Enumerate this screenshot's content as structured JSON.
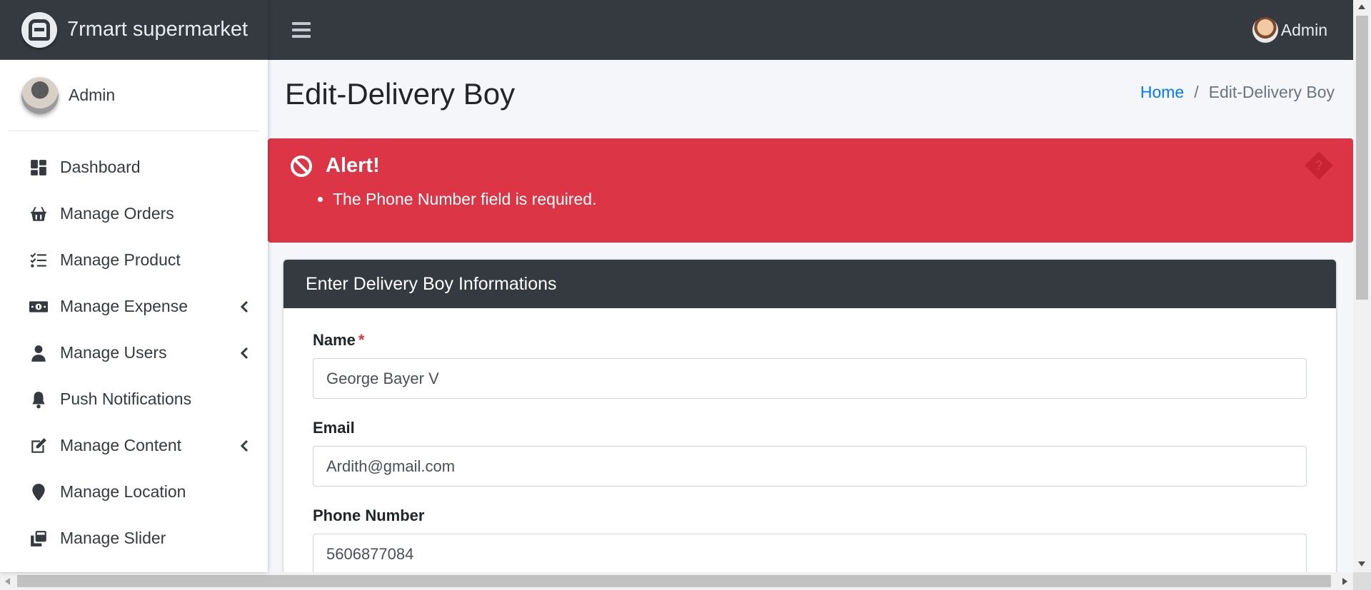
{
  "brand": {
    "name": "7rmart supermarket",
    "icon": "brand-logo-icon"
  },
  "sidebar": {
    "user": {
      "name": "Admin"
    },
    "items": [
      {
        "label": "Dashboard",
        "icon": "dashboard-icon",
        "has_submenu": false
      },
      {
        "label": "Manage Orders",
        "icon": "basket-icon",
        "has_submenu": false
      },
      {
        "label": "Manage Product",
        "icon": "tasks-icon",
        "has_submenu": false
      },
      {
        "label": "Manage Expense",
        "icon": "money-icon",
        "has_submenu": true
      },
      {
        "label": "Manage Users",
        "icon": "user-icon",
        "has_submenu": true
      },
      {
        "label": "Push Notifications",
        "icon": "bell-icon",
        "has_submenu": false
      },
      {
        "label": "Manage Content",
        "icon": "edit-icon",
        "has_submenu": true
      },
      {
        "label": "Manage Location",
        "icon": "map-marker-icon",
        "has_submenu": false
      },
      {
        "label": "Manage Slider",
        "icon": "clone-icon",
        "has_submenu": false
      }
    ]
  },
  "topbar": {
    "user_name": "Admin"
  },
  "page": {
    "title": "Edit-Delivery Boy",
    "breadcrumb": {
      "home": "Home",
      "separator": "/",
      "current": "Edit-Delivery Boy"
    }
  },
  "alert": {
    "title": "Alert!",
    "messages": [
      "The Phone Number field is required."
    ],
    "color": "#dc3545"
  },
  "form": {
    "header": "Enter Delivery Boy Informations",
    "name": {
      "label": "Name",
      "required_mark": "*",
      "value": "George Bayer V"
    },
    "email": {
      "label": "Email",
      "value": "Ardith@gmail.com"
    },
    "phone": {
      "label": "Phone Number",
      "value": "5606877084"
    }
  },
  "colors": {
    "dark": "#343a40",
    "link": "#007bff",
    "danger": "#dc3545"
  }
}
